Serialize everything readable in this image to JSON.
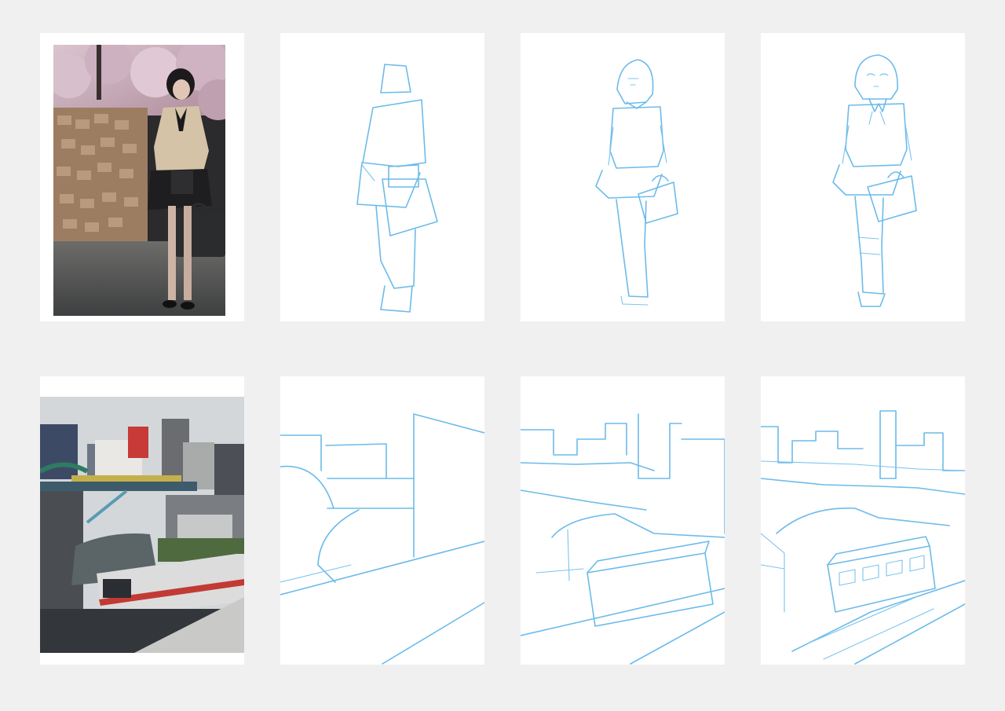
{
  "rows": [
    {
      "subject": "figure",
      "panels": [
        {
          "kind": "photo"
        },
        {
          "kind": "sketch-rough"
        },
        {
          "kind": "sketch-mid"
        },
        {
          "kind": "sketch-final"
        }
      ]
    },
    {
      "subject": "cityscape",
      "panels": [
        {
          "kind": "photo"
        },
        {
          "kind": "sketch-rough"
        },
        {
          "kind": "sketch-mid"
        },
        {
          "kind": "sketch-final"
        }
      ]
    }
  ],
  "colors": {
    "background": "#f0f0f0",
    "card": "#ffffff",
    "sketch_line": "#6cbbea"
  }
}
